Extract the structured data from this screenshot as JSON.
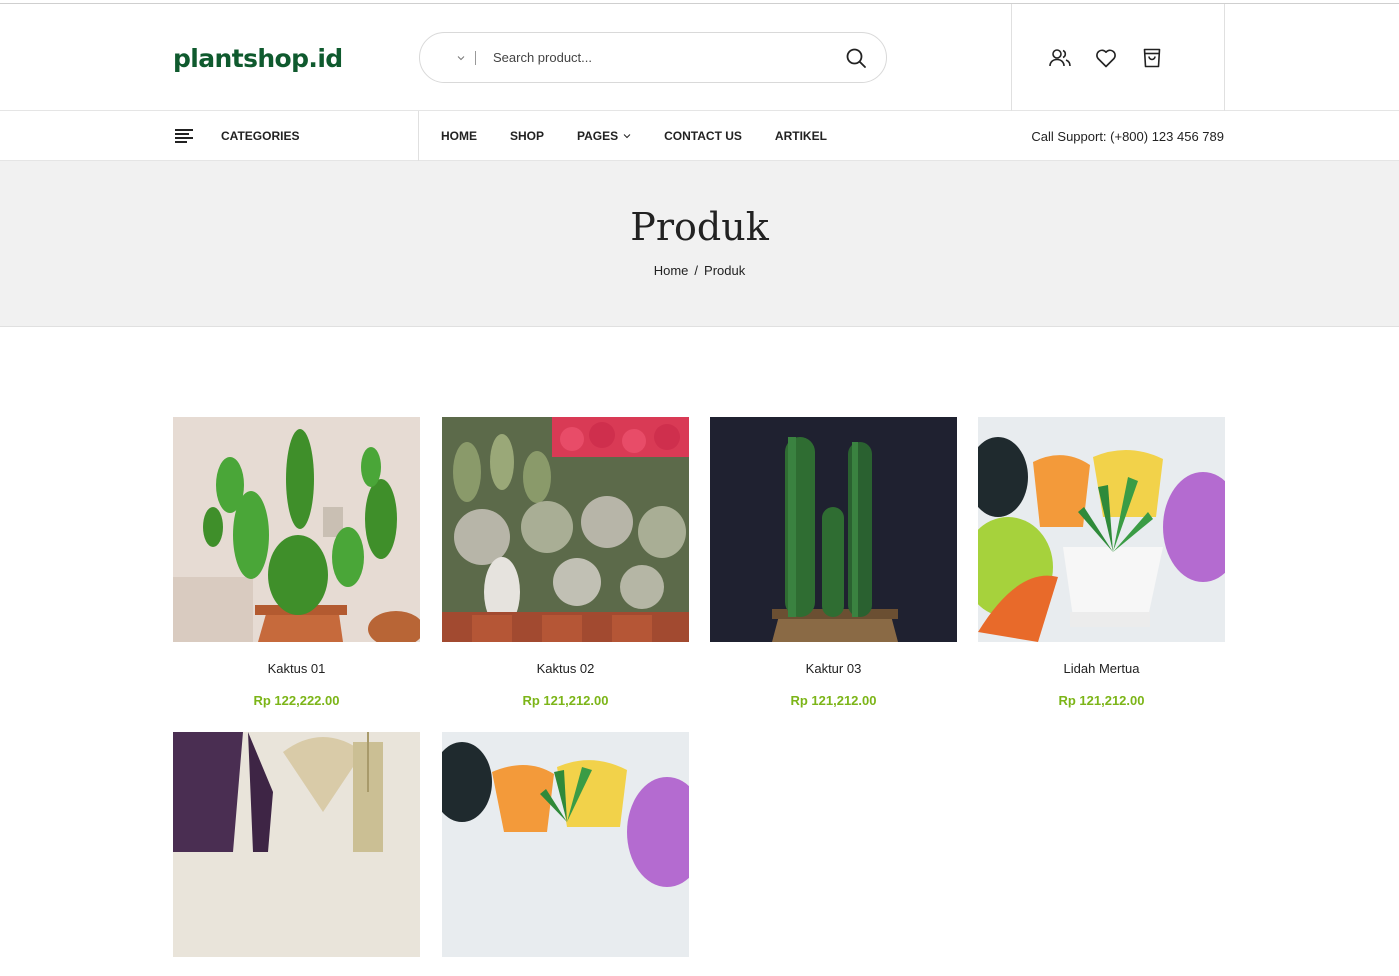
{
  "brand": {
    "logo_text": "plantshop.id"
  },
  "search": {
    "placeholder": "Search product..."
  },
  "header_icons": [
    "account-icon",
    "heart-icon",
    "cart-icon"
  ],
  "nav": {
    "categories_label": "CATEGORIES",
    "menu": [
      "HOME",
      "SHOP",
      "PAGES",
      "CONTACT US",
      "ARTIKEL"
    ],
    "support": "Call Support: (+800) 123 456 789"
  },
  "banner": {
    "title": "Produk",
    "breadcrumb": {
      "home": "Home",
      "separator": "/",
      "current": "Produk"
    }
  },
  "products": [
    {
      "name": "Kaktus 01",
      "price": "Rp 122,222.00"
    },
    {
      "name": "Kaktus 02",
      "price": "Rp 121,212.00"
    },
    {
      "name": "Kaktur 03",
      "price": "Rp 121,212.00"
    },
    {
      "name": "Lidah Mertua",
      "price": "Rp 121,212.00"
    },
    {
      "name": "",
      "price": ""
    },
    {
      "name": "",
      "price": ""
    }
  ],
  "colors": {
    "price": "#7cb518",
    "logo": "#0f5a2e",
    "banner_bg": "#f1f1f1"
  }
}
